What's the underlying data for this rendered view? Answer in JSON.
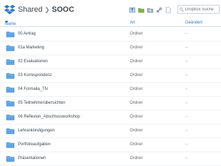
{
  "breadcrumb": {
    "parent": "Shared",
    "current": "SOOC"
  },
  "search": {
    "placeholder": "Dropbox Suche"
  },
  "columns": {
    "name": "Name",
    "type": "Art",
    "modified": "Geändert"
  },
  "colors": {
    "accent": "#2a7cc7",
    "folder": "#5fa3e0"
  },
  "rows": [
    {
      "name": "00 Antrag",
      "type": "Ordner",
      "modified": "--"
    },
    {
      "name": "01a Marketing",
      "type": "Ordner",
      "modified": "--"
    },
    {
      "name": "02 Evaluationen",
      "type": "Ordner",
      "modified": "--"
    },
    {
      "name": "03 Korrespondenz",
      "type": "Ordner",
      "modified": "--"
    },
    {
      "name": "04 Formalia_TN",
      "type": "Ordner",
      "modified": "--"
    },
    {
      "name": "05 Teilnehmerübersichten",
      "type": "Ordner",
      "modified": "--"
    },
    {
      "name": "06 Reflexion_Abschlussworkshop",
      "type": "Ordner",
      "modified": "--"
    },
    {
      "name": "Lehrankündigungen",
      "type": "Ordner",
      "modified": "--"
    },
    {
      "name": "Portfolioaufgaben",
      "type": "Ordner",
      "modified": "--"
    },
    {
      "name": "Präsentationen",
      "type": "Ordner",
      "modified": "--"
    }
  ]
}
